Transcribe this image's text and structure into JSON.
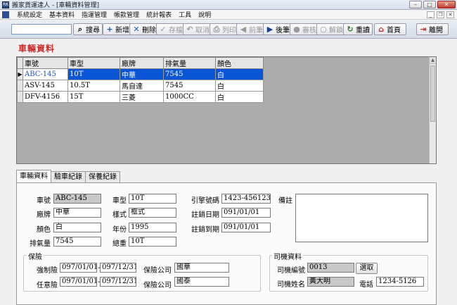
{
  "window": {
    "title": "搬家貨運達人 - [車輛資料管理]",
    "app_icon_text": "RK"
  },
  "menu": {
    "items": [
      "系統設定",
      "基本資料",
      "指運管理",
      "帳款管理",
      "統計報表",
      "工具",
      "說明"
    ]
  },
  "toolbar": {
    "search_value": "",
    "buttons": [
      {
        "label": "搜尋",
        "icon": "search-icon",
        "glyph": "⌕"
      },
      {
        "label": "新增",
        "icon": "plus-icon",
        "glyph": "+"
      },
      {
        "label": "刪除",
        "icon": "x-icon",
        "glyph": "✕"
      },
      {
        "label": "存檔",
        "icon": "check-icon",
        "glyph": "✓"
      },
      {
        "label": "取消",
        "icon": "undo-icon",
        "glyph": "↶"
      },
      {
        "label": "列印",
        "icon": "printer-icon",
        "glyph": "⎙"
      },
      {
        "label": "前筆",
        "icon": "previous-icon",
        "glyph": "◀"
      },
      {
        "label": "後筆",
        "icon": "next-icon",
        "glyph": "▶"
      },
      {
        "label": "審核",
        "icon": "lock-icon",
        "glyph": "●"
      },
      {
        "label": "解鎖",
        "icon": "unlock-icon",
        "glyph": "○"
      },
      {
        "label": "重讀",
        "icon": "refresh-icon",
        "glyph": "↻"
      },
      {
        "label": "首頁",
        "icon": "home-icon",
        "glyph": "⌂"
      },
      {
        "label": "離開",
        "icon": "exit-icon",
        "glyph": "⇥"
      }
    ]
  },
  "section_title": "車輛資料",
  "grid": {
    "columns": [
      "車號",
      "車型",
      "廠牌",
      "排氣量",
      "顏色"
    ],
    "rows": [
      [
        "ABC-145",
        "10T",
        "中華",
        "7545",
        "白"
      ],
      [
        "ASV-145",
        "10.5T",
        "馬自達",
        "7545",
        "白"
      ],
      [
        "DFV-4156",
        "15T",
        "三菱",
        "1000CC",
        "白"
      ]
    ],
    "selected_row": 0,
    "indicator": "▶"
  },
  "tabs": [
    "車輛資料",
    "驗車紀錄",
    "保養紀錄"
  ],
  "form": {
    "plate_label": "車號",
    "plate": "ABC-145",
    "type_label": "車型",
    "type": "10T",
    "engine_label": "引擎號碼",
    "engine": "1423-456123",
    "remark_label": "備註",
    "brand_label": "廠牌",
    "brand": "中華",
    "style_label": "樣式",
    "style": "框式",
    "reg_date_label": "註銷日期",
    "reg_date": "091/01/01",
    "color_label": "顏色",
    "color": "白",
    "year_label": "年份",
    "year": "1995",
    "expire_label": "註銷到期",
    "expire": "091/01/01",
    "cc_label": "排氣量",
    "cc": "7545",
    "weight_label": "總重",
    "weight": "10T",
    "insurance_title": "保險",
    "compulsory_label": "強制險",
    "compulsory_from": "097/01/01",
    "compulsory_to": "097/12/31",
    "voluntary_label": "任意險",
    "voluntary_from": "097/01/01",
    "voluntary_to": "097/12/31",
    "company_label": "保險公司",
    "company1": "國華",
    "company2": "國泰",
    "driver_title": "司機資料",
    "driver_id_label": "司機編號",
    "driver_id": "0013",
    "pick_label": "選取",
    "driver_name_label": "司機姓名",
    "driver_name": "黃大明",
    "phone_label": "電話",
    "phone": "1234-5126"
  }
}
